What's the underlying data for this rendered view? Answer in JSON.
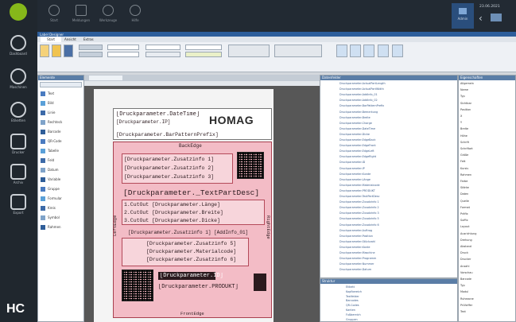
{
  "topbar": {
    "items": [
      {
        "label": "Start",
        "icon": "gear-icon"
      },
      {
        "label": "Meldungen",
        "icon": "warning-icon"
      },
      {
        "label": "Werkzeuge",
        "icon": "bulb-icon"
      },
      {
        "label": "Hilfe",
        "icon": "clock-icon"
      }
    ],
    "date": "23.06.2021",
    "user_label": "Admin"
  },
  "rail": {
    "items": [
      {
        "label": "Dashboard"
      },
      {
        "label": "Maschinen"
      },
      {
        "label": "Etiketten"
      },
      {
        "label": "Drucker"
      },
      {
        "label": "Archiv"
      },
      {
        "label": "Export"
      }
    ],
    "logo": "HC"
  },
  "window": {
    "title": "Label Designer",
    "tabs": [
      "Start",
      "Ansicht",
      "Extras"
    ]
  },
  "label": {
    "header_lines": [
      "[Druckparameter.DateTime]",
      "[Druckparameter.IP]",
      "[Druckparameter.BarPatternPrefix]"
    ],
    "brand": "HOMAG",
    "edge_top": "BackEdge",
    "field_1": "[Druckparameter.Zusatzinfo 1]",
    "field_2": "[Druckparameter.Zusatzinfo 2]",
    "field_3": "[Druckparameter.Zusatzinfo 3]",
    "part_desc": "[Druckparameter._TextPartDesc]",
    "cutout_1": "1.CutOut [Druckparameter.Länge]",
    "cutout_2": "2.CutOut [Druckparameter.Breite]",
    "cutout_3": "3.CutOut [Druckparameter.Dicke]",
    "info_row": "[Druckparameter.Zusatzinfo 1] [AddInfo_01]",
    "mid_1": "[Druckparameter.Zusatzinfo 5]",
    "mid_2": "[Druckparameter.Materialcode]",
    "mid_3": "[Druckparameter.Zusatzinfo 6]",
    "id_highlight": "[Druckparameter.ID]",
    "produkt": "[Druckparameter.PRODUKT]",
    "edge_left": "LeftEdge",
    "edge_right": "RightEdge",
    "edge_bottom": "FrontEdge"
  },
  "toolbox": {
    "title": "Elemente",
    "items": [
      "Text",
      "Bild",
      "Linie",
      "Rechteck",
      "Barcode",
      "QR-Code",
      "Tabelle",
      "Feld",
      "Datum",
      "Variable",
      "Gruppe",
      "Formular",
      "Kreis",
      "Symbol",
      "Rahmen"
    ]
  },
  "fields_list": {
    "title": "Datenfelder",
    "items": [
      "Druckparameter.ActualPartLength",
      "Druckparameter.ActualPartWidth",
      "Druckparameter.AddInfo_01",
      "Druckparameter.AddInfo_02",
      "Druckparameter.BarPatternPrefix",
      "Druckparameter.Bemerkung",
      "Druckparameter.Breite",
      "Druckparameter.Charge",
      "Druckparameter.DateTime",
      "Druckparameter.Dicke",
      "Druckparameter.EdgeBack",
      "Druckparameter.EdgeFront",
      "Druckparameter.EdgeLeft",
      "Druckparameter.EdgeRight",
      "Druckparameter.ID",
      "Druckparameter.IP",
      "Druckparameter.Kunde",
      "Druckparameter.Länge",
      "Druckparameter.Materialcode",
      "Druckparameter.PRODUKT",
      "Druckparameter.TextPartDesc",
      "Druckparameter.Zusatzinfo 1",
      "Druckparameter.Zusatzinfo 2",
      "Druckparameter.Zusatzinfo 3",
      "Druckparameter.Zusatzinfo 5",
      "Druckparameter.Zusatzinfo 6",
      "Druckparameter.Auftrag",
      "Druckparameter.Position",
      "Druckparameter.Stückzahl",
      "Druckparameter.Kante",
      "Druckparameter.Maschine",
      "Druckparameter.Programm",
      "Druckparameter.Nummer",
      "Druckparameter.Datum"
    ]
  },
  "lower_list": {
    "title": "Struktur",
    "items": [
      "Etikett",
      "  Kopfbereich",
      "  Textfelder",
      "  Barcodes",
      "  QR-Codes",
      "  Kanten",
      "  Fußbereich",
      "  Gruppen"
    ]
  },
  "properties": {
    "title": "Eigenschaften",
    "items": [
      "Allgemein",
      "  Name",
      "  Typ",
      "  Sichtbar",
      "Position",
      "  X",
      "  Y",
      "  Breite",
      "  Höhe",
      "Schrift",
      "  Schriftart",
      "  Größe",
      "  Fett",
      "  Kursiv",
      "Rahmen",
      "  Farbe",
      "  Stärke",
      "Daten",
      "  Quelle",
      "  Format",
      "  Präfix",
      "  Suffix",
      "Layout",
      "  Ausrichtung",
      "  Drehung",
      "  Abstand",
      "Druck",
      "  Drucker",
      "  Anzahl",
      "  Vorschau",
      "Barcode",
      "  Typ",
      "  Modul",
      "  Ruhezone",
      "  Prüfziffer",
      "  Text"
    ]
  }
}
